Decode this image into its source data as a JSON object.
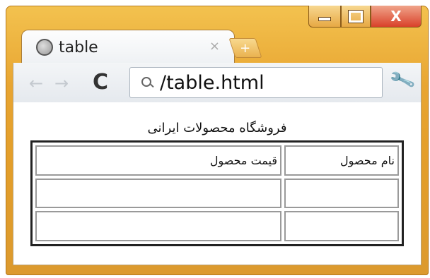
{
  "window": {
    "controls": [
      "minimize",
      "maximize",
      "close"
    ]
  },
  "tab": {
    "title": "table",
    "close_glyph": "×",
    "new_tab_glyph": "+"
  },
  "toolbar": {
    "back_glyph": "←",
    "forward_glyph": "→",
    "reload_glyph": "C",
    "url": "/table.html",
    "wrench_glyph": "🔧"
  },
  "page": {
    "heading": "فروشگاه محصولات ایرانی",
    "table": {
      "headers": [
        "نام محصول",
        "قیمت محصول"
      ],
      "rows": [
        [
          "",
          ""
        ],
        [
          "",
          ""
        ]
      ]
    }
  }
}
